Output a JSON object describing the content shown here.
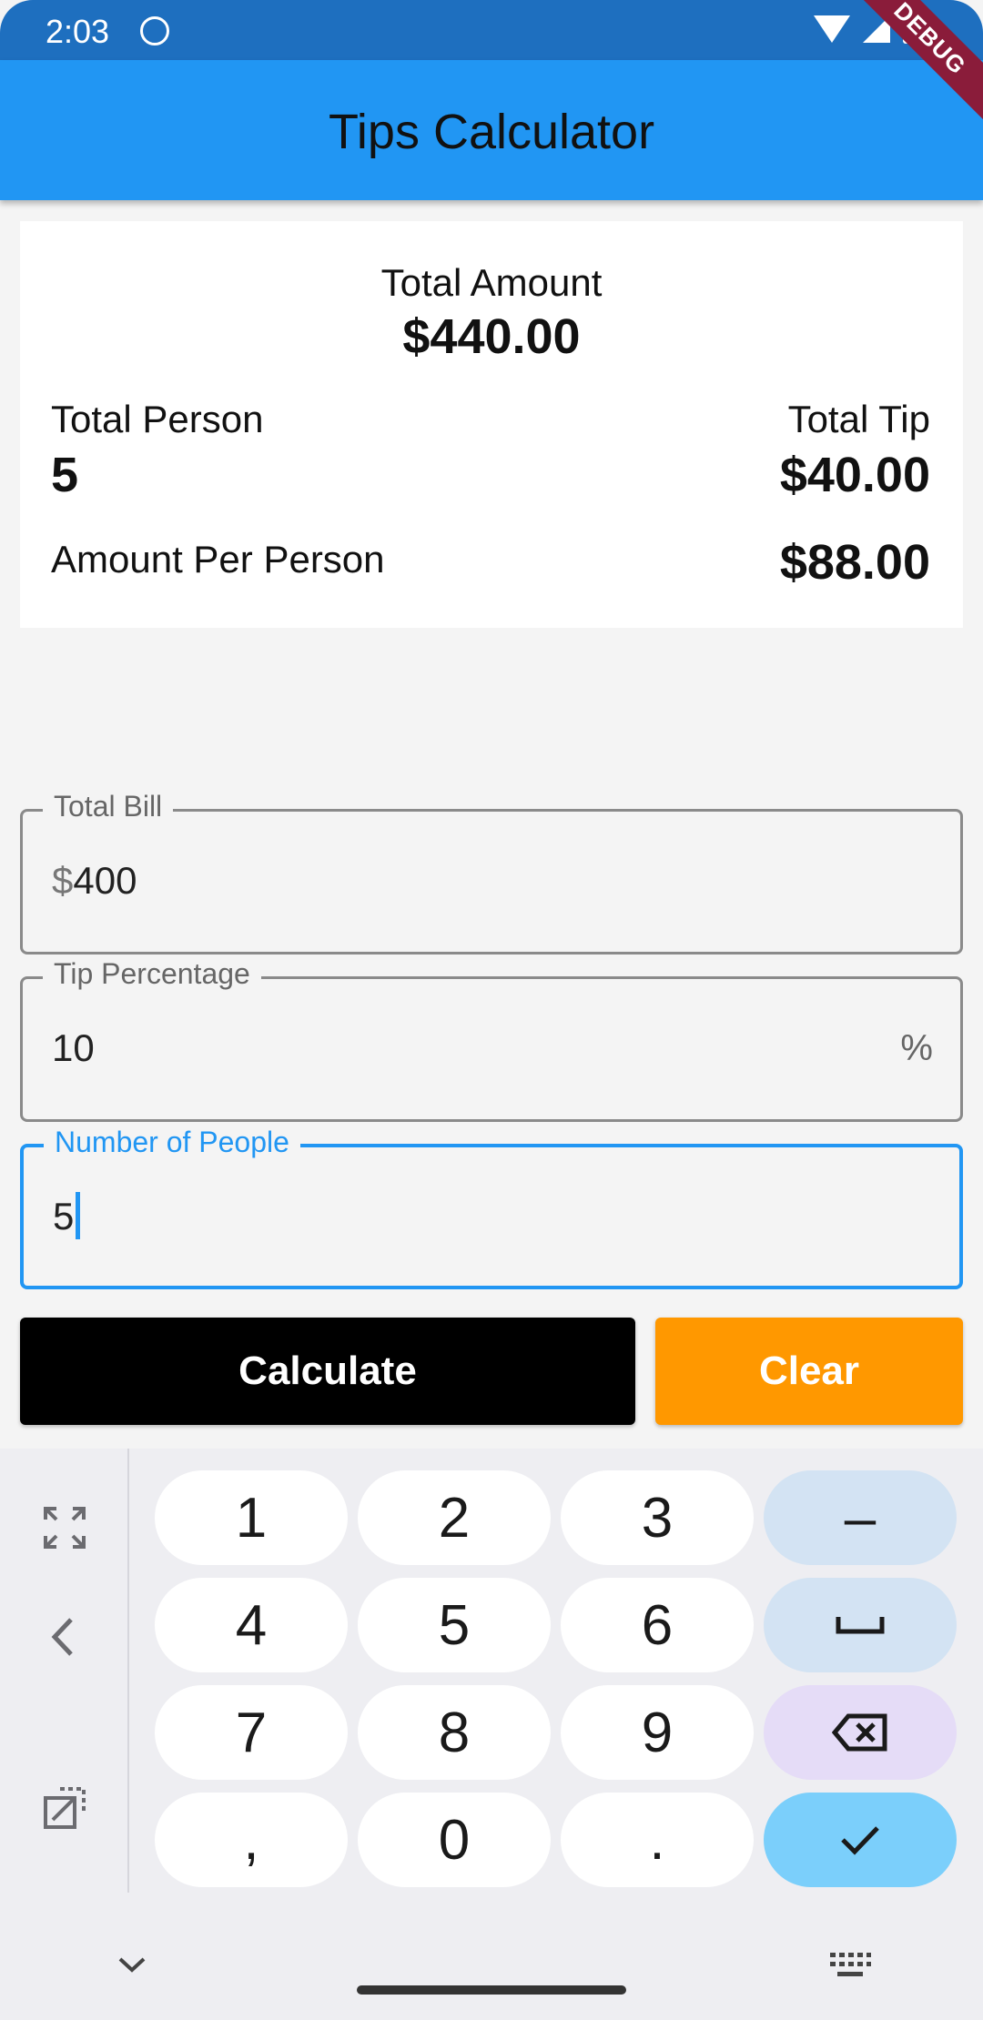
{
  "status_bar": {
    "time": "2:03"
  },
  "app_bar": {
    "title": "Tips Calculator",
    "debug_banner": "DEBUG"
  },
  "summary": {
    "total_amount_label": "Total Amount",
    "total_amount_value": "$440.00",
    "total_person_label": "Total Person",
    "total_person_value": "5",
    "total_tip_label": "Total Tip",
    "total_tip_value": "$40.00",
    "per_person_label": "Amount Per Person",
    "per_person_value": "$88.00"
  },
  "fields": {
    "total_bill": {
      "label": "Total Bill",
      "prefix": "$",
      "value": "400"
    },
    "tip_percentage": {
      "label": "Tip Percentage",
      "value": "10",
      "suffix": "%"
    },
    "people": {
      "label": "Number of People",
      "value": "5",
      "focused": true
    }
  },
  "buttons": {
    "calculate": "Calculate",
    "clear": "Clear"
  },
  "keyboard": {
    "rows": [
      [
        "1",
        "2",
        "3",
        "–"
      ],
      [
        "4",
        "5",
        "6",
        "space"
      ],
      [
        "7",
        "8",
        "9",
        "backspace"
      ],
      [
        ",",
        "0",
        ".",
        "done"
      ]
    ],
    "side_icons": [
      "expand-icon",
      "back-chevron-icon",
      "popout-icon"
    ],
    "bottom_icons": [
      "collapse-chevron-icon",
      "keyboard-icon"
    ]
  },
  "colors": {
    "app_bar": "#2196f3",
    "status_bar": "#1e6fbf",
    "focus": "#2196f3",
    "calculate_button": "#000000",
    "clear_button": "#ff9800"
  }
}
